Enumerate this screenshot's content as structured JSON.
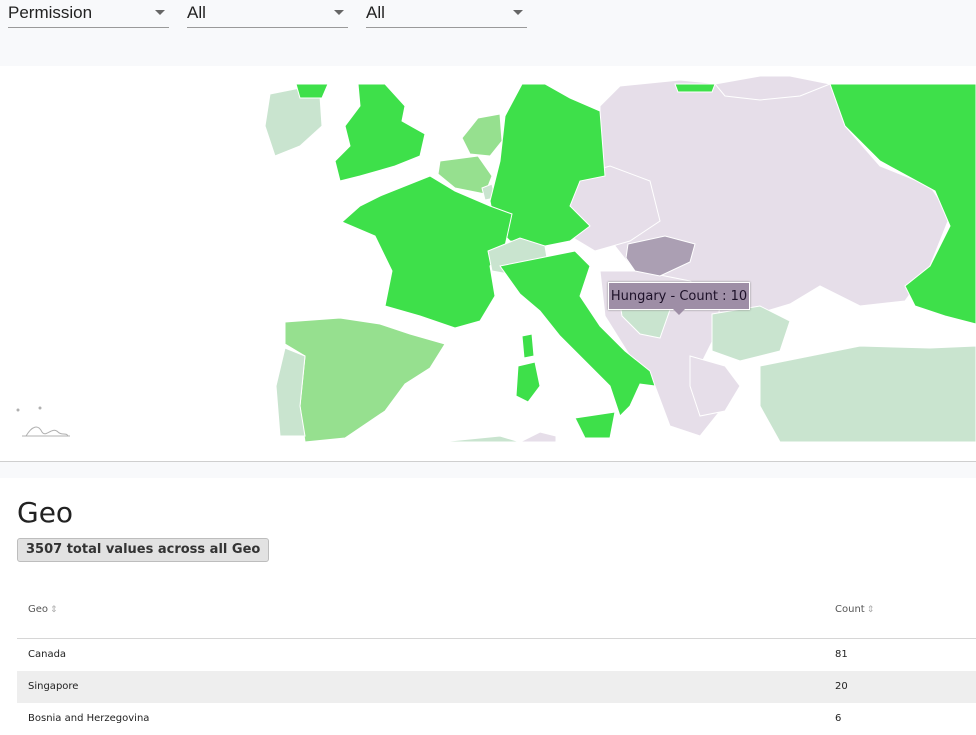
{
  "filters": {
    "permission": "Permission",
    "filter2": "All",
    "filter3": "All"
  },
  "map": {
    "tooltip": "Hungary - Count : 10",
    "colors": {
      "high": "#3ee04a",
      "medium": "#96e08f",
      "low": "#c9e4cf",
      "none": "#e6dee9",
      "hover": "#ab9fb3"
    }
  },
  "geo": {
    "title": "Geo",
    "badge": "3507 total values across all Geo",
    "columns": {
      "geo": "Geo",
      "count": "Count"
    },
    "rows": [
      {
        "geo": "Canada",
        "count": "81"
      },
      {
        "geo": "Singapore",
        "count": "20"
      },
      {
        "geo": "Bosnia and Herzegovina",
        "count": "6"
      }
    ]
  }
}
